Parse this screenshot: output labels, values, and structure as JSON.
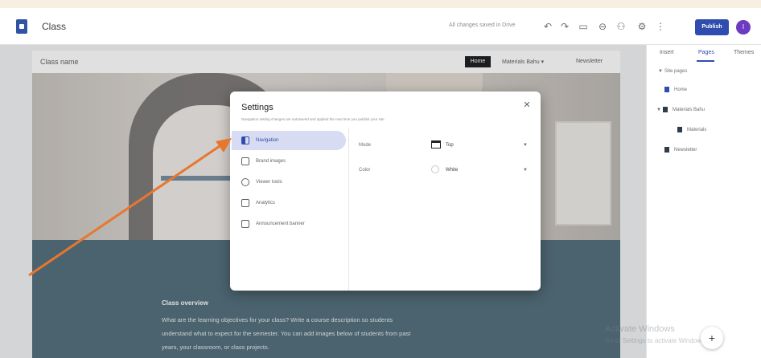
{
  "app": {
    "title": "Class",
    "save_status": "All changes saved in Drive",
    "publish_label": "Publish",
    "avatar_initial": "I"
  },
  "toolbar_icons": [
    "undo-icon",
    "redo-icon",
    "preview-icon",
    "link-icon",
    "add-person-icon",
    "settings-icon",
    "more-icon"
  ],
  "site": {
    "title": "Class name",
    "nav": {
      "home": "Home",
      "item2": "Materials Bahu",
      "item3": "Newsletter"
    },
    "overview_title": "Class overview",
    "overview_lines": [
      "What are the learning objectives for your class? Write a course description so students",
      "understand what to expect for the semester. You can add images below of students from past",
      "years, your classroom, or class projects."
    ]
  },
  "side_panel": {
    "tabs": [
      "Insert",
      "Pages",
      "Themes"
    ],
    "active_tab": "Pages",
    "section": "Site pages",
    "pages": [
      "Home",
      "Materials Bahu",
      "Materials",
      "Newsletter"
    ]
  },
  "dialog": {
    "title": "Settings",
    "subtitle": "Navigation setting changes are autosaved and applied the next time you publish your site",
    "nav_items": [
      "Navigation",
      "Brand images",
      "Viewer tools",
      "Analytics",
      "Announcement banner"
    ],
    "active_item": "Navigation",
    "fields": [
      {
        "label": "Mode",
        "value": "Top"
      },
      {
        "label": "Color",
        "value": "White"
      }
    ]
  },
  "watermark": {
    "line1": "Activate Windows",
    "line2": "Go to Settings to activate Windows."
  },
  "colors": {
    "accent": "#2f4dae",
    "overview_bg": "#56717f",
    "annotation_arrow": "#e8772e"
  }
}
